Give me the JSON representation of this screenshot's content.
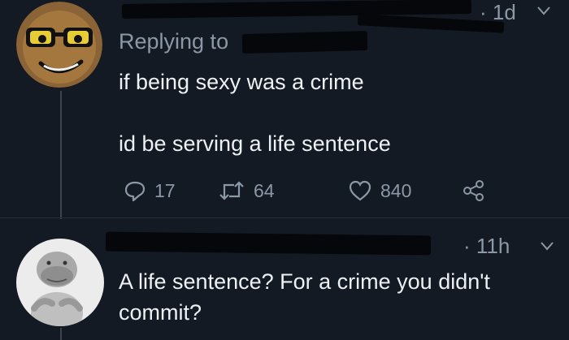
{
  "colors": {
    "background": "#141a24",
    "text": "#eef1f4",
    "secondary_text": "#8b98a5",
    "thread_line": "#3a4552"
  },
  "original_tweet": {
    "avatar_icon": "sunglasses-face-avatar",
    "timestamp": "· 1d",
    "replying_to_label": "Replying to",
    "text_line_1": "if being sexy was a crime",
    "text_line_2": "id be serving a life sentence",
    "actions": {
      "reply_icon": "reply-icon",
      "reply_count": "17",
      "retweet_icon": "retweet-icon",
      "retweet_count": "64",
      "like_icon": "heart-icon",
      "like_count": "840",
      "share_icon": "share-icon"
    }
  },
  "reply_tweet": {
    "avatar_icon": "creature-photo-avatar",
    "timestamp": "· 11h",
    "text_line_1": "A life sentence? For a crime you didn't",
    "text_line_2": "commit?"
  }
}
